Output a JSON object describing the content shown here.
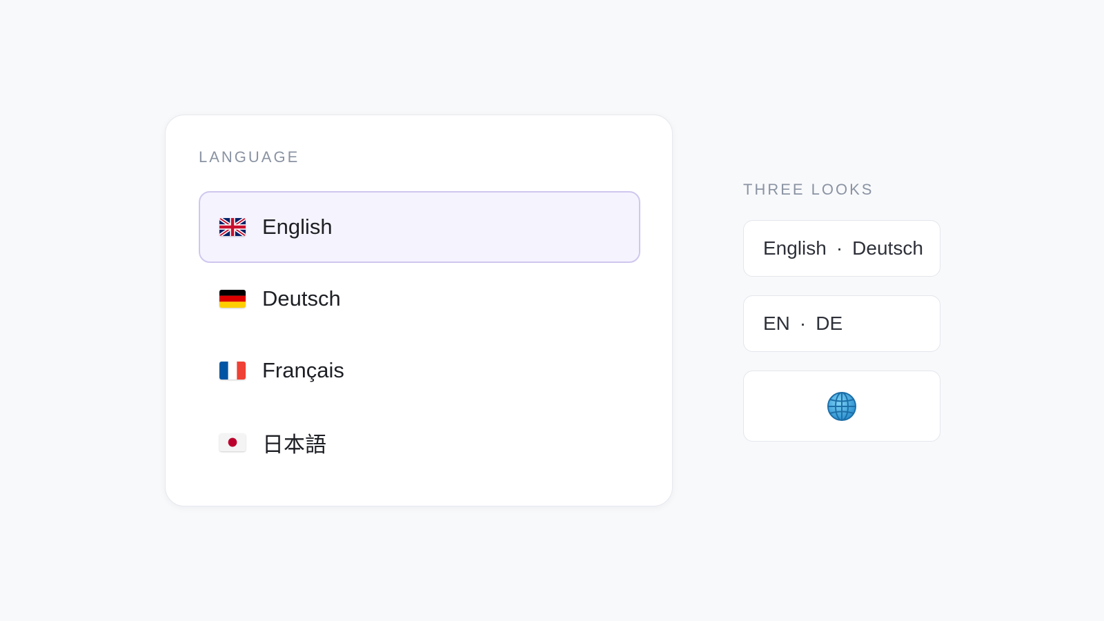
{
  "language_card": {
    "label": "LANGUAGE",
    "items": [
      {
        "name": "English",
        "flag": "uk-flag-icon",
        "selected": true
      },
      {
        "name": "Deutsch",
        "flag": "germany-flag-icon",
        "selected": false
      },
      {
        "name": "Français",
        "flag": "france-flag-icon",
        "selected": false
      },
      {
        "name": "日本語",
        "flag": "japan-flag-icon",
        "selected": false
      }
    ]
  },
  "looks": {
    "label": "THREE LOOKS",
    "full": {
      "first": "English",
      "separator": "·",
      "second": "Deutsch"
    },
    "short": {
      "first": "EN",
      "separator": "·",
      "second": "DE"
    },
    "icon": "globe-icon"
  },
  "colors": {
    "selected_bg": "#f5f3fe",
    "selected_border": "#cfc7ee",
    "label": "#8a93a2",
    "globe": "#3aa0d8"
  }
}
